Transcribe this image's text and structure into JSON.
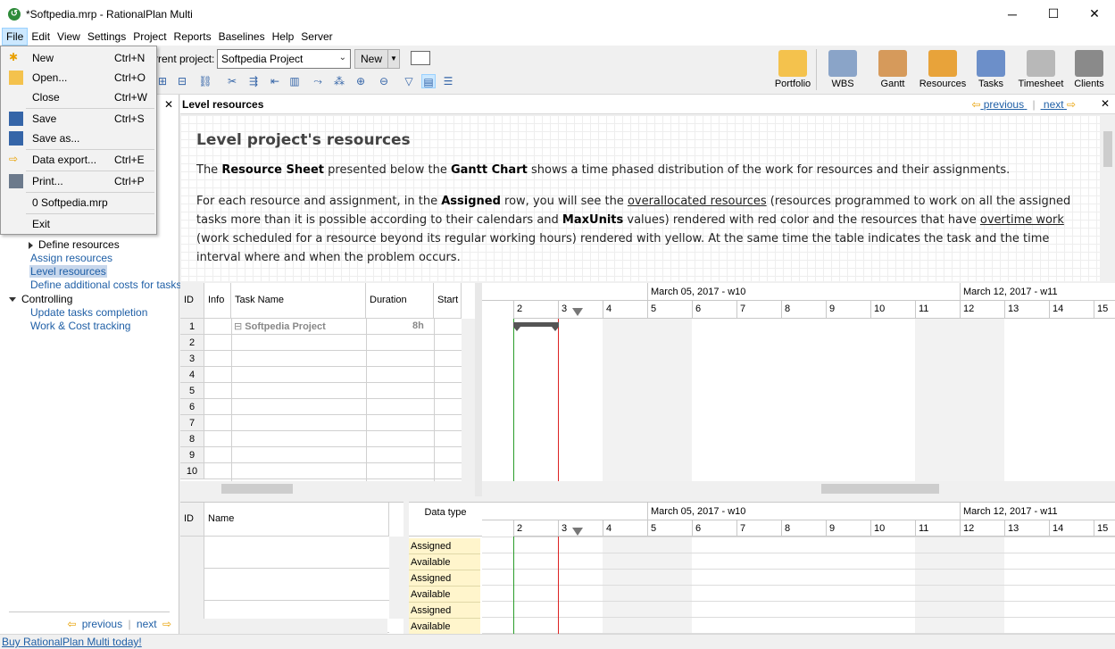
{
  "window": {
    "title": "*Softpedia.mrp - RationalPlan Multi",
    "min": "─",
    "max": "☐",
    "close": "✕"
  },
  "menubar": [
    "File",
    "Edit",
    "View",
    "Settings",
    "Project",
    "Reports",
    "Baselines",
    "Help",
    "Server"
  ],
  "toolbar": {
    "current_project_label": "rrent project:",
    "current_project_value": "Softpedia Project",
    "new_label": "New",
    "views": [
      {
        "label": "Portfolio",
        "color": "#f4c24d"
      },
      {
        "label": "WBS",
        "color": "#8aa4c8"
      },
      {
        "label": "Gantt",
        "color": "#d69a5b"
      },
      {
        "label": "Resources",
        "color": "#e8a33a"
      },
      {
        "label": "Tasks",
        "color": "#6c8fc9"
      },
      {
        "label": "Timesheet",
        "color": "#b8b8b8"
      },
      {
        "label": "Clients",
        "color": "#8a8a8a"
      }
    ]
  },
  "file_menu": [
    {
      "label": "New",
      "shortcut": "Ctrl+N",
      "icon": "new-file-icon"
    },
    {
      "label": "Open...",
      "shortcut": "Ctrl+O",
      "icon": "open-folder-icon"
    },
    {
      "label": "Close",
      "shortcut": "Ctrl+W",
      "icon": ""
    },
    {
      "label": "Save",
      "shortcut": "Ctrl+S",
      "icon": "save-icon"
    },
    {
      "label": "Save as...",
      "shortcut": "",
      "icon": "save-as-icon"
    },
    {
      "label": "Data export...",
      "shortcut": "Ctrl+E",
      "icon": "export-icon"
    },
    {
      "label": "Print...",
      "shortcut": "Ctrl+P",
      "icon": "print-icon"
    },
    {
      "label": "0 Softpedia.mrp",
      "shortcut": "",
      "icon": ""
    },
    {
      "label": "Exit",
      "shortcut": "",
      "icon": ""
    }
  ],
  "left_panel": {
    "items": [
      {
        "label": "Define resources",
        "type": "node"
      },
      {
        "label": "Assign resources",
        "type": "link"
      },
      {
        "label": "Level resources",
        "type": "selected"
      },
      {
        "label": "Define additional costs for tasks",
        "type": "link"
      },
      {
        "label": "Controlling",
        "type": "group"
      },
      {
        "label": "Update tasks completion",
        "type": "link"
      },
      {
        "label": "Work & Cost tracking",
        "type": "link"
      }
    ],
    "prev": "previous",
    "next": "next"
  },
  "help": {
    "header": "Level resources",
    "prev": "previous",
    "next": "next",
    "heading": "Level project's resources",
    "p1_a": "The ",
    "p1_b": "Resource Sheet",
    "p1_c": " presented below the ",
    "p1_d": "Gantt Chart",
    "p1_e": " shows a time phased distribution of the work for resources and their assignments.",
    "p2_a": "For each resource and assignment, in the ",
    "p2_b": "Assigned",
    "p2_c": " row, you will see the ",
    "p2_d": "overallocated resources",
    "p2_e": " (resources programmed to work on all the assigned tasks more than it is possible according to their calendars and ",
    "p2_f": "MaxUnits",
    "p2_g": " values) rendered with red color and the resources that have ",
    "p2_h": "overtime work",
    "p2_i": " (work scheduled for a resource beyond its regular working hours) rendered with yellow. At the same time the table indicates the task and the time interval where and when the problem occurs."
  },
  "task_table": {
    "headers": [
      "ID",
      "Info",
      "Task Name",
      "Duration",
      "Start"
    ],
    "project_row": {
      "name": "Softpedia Project",
      "duration": "8h"
    },
    "rows": [
      "1",
      "2",
      "3",
      "4",
      "5",
      "6",
      "7",
      "8",
      "9",
      "10"
    ]
  },
  "gantt": {
    "weeks": [
      "March 05, 2017 - w10",
      "March 12, 2017 - w11"
    ],
    "days": [
      "2",
      "3",
      "4",
      "5",
      "6",
      "7",
      "8",
      "9",
      "10",
      "11",
      "12",
      "13",
      "14",
      "15"
    ]
  },
  "resource_table": {
    "headers": [
      "ID",
      "Name"
    ],
    "data_type_header": "Data type",
    "data_types": [
      "Assigned",
      "Available",
      "Assigned",
      "Available",
      "Assigned",
      "Available"
    ]
  },
  "statusbar": {
    "link": "Buy RationalPlan Multi today!"
  }
}
